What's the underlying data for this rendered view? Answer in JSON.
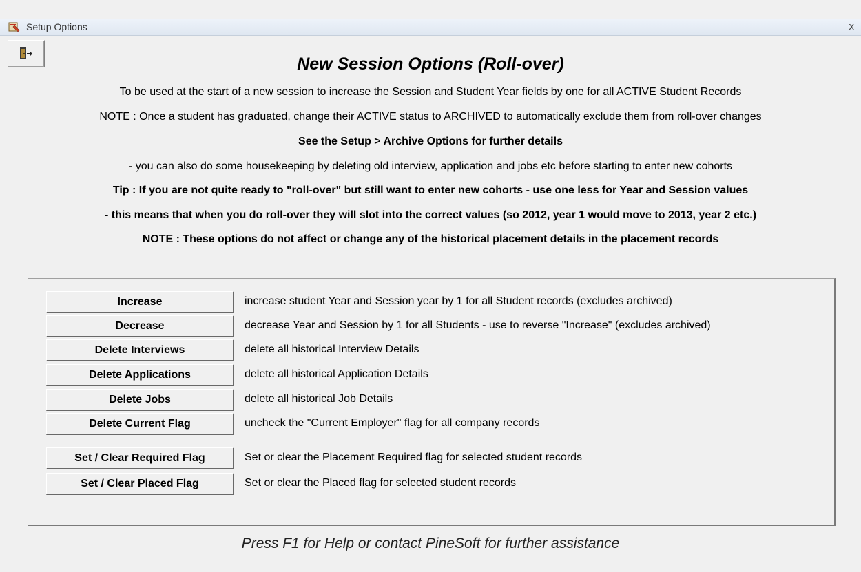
{
  "window": {
    "title": "Setup Options",
    "close_label": "x"
  },
  "heading": "New Session Options (Roll-over)",
  "info_lines": [
    "To be used at the start of a new session to increase the Session and Student Year fields by one for all ACTIVE Student Records",
    "NOTE : Once a student has graduated, change their ACTIVE status to ARCHIVED to automatically exclude them from roll-over changes",
    "See the Setup > Archive Options for further details",
    "- you can also do some housekeeping by deleting old interview, application and jobs etc before starting to enter new cohorts",
    "Tip : If you are not quite ready to \"roll-over\" but still want to enter new cohorts - use one less for Year and Session values",
    "- this means that when you do roll-over they will slot into the correct values (so 2012, year 1 would move to 2013, year 2 etc.)",
    "NOTE : These options do not affect or change any of the historical placement details in the placement records"
  ],
  "actions": [
    {
      "label": "Increase",
      "description": "increase student Year and Session year by 1 for all Student records (excludes archived)"
    },
    {
      "label": "Decrease",
      "description": "decrease Year and Session by 1 for all Students - use to reverse \"Increase\" (excludes archived)"
    },
    {
      "label": "Delete Interviews",
      "description": "delete all historical Interview Details"
    },
    {
      "label": "Delete Applications",
      "description": "delete all historical Application Details"
    },
    {
      "label": "Delete Jobs",
      "description": "delete all historical Job Details"
    },
    {
      "label": "Delete Current Flag",
      "description": "uncheck the \"Current Employer\" flag for all company records"
    },
    {
      "label": "Set / Clear Required Flag",
      "description": "Set or clear the Placement Required flag for selected student records"
    },
    {
      "label": "Set / Clear Placed Flag",
      "description": "Set or clear the Placed flag for selected student records"
    }
  ],
  "footer": "Press F1 for Help or contact PineSoft for further assistance",
  "icons": {
    "app": "setup-app-icon",
    "exit": "exit-door-icon"
  }
}
